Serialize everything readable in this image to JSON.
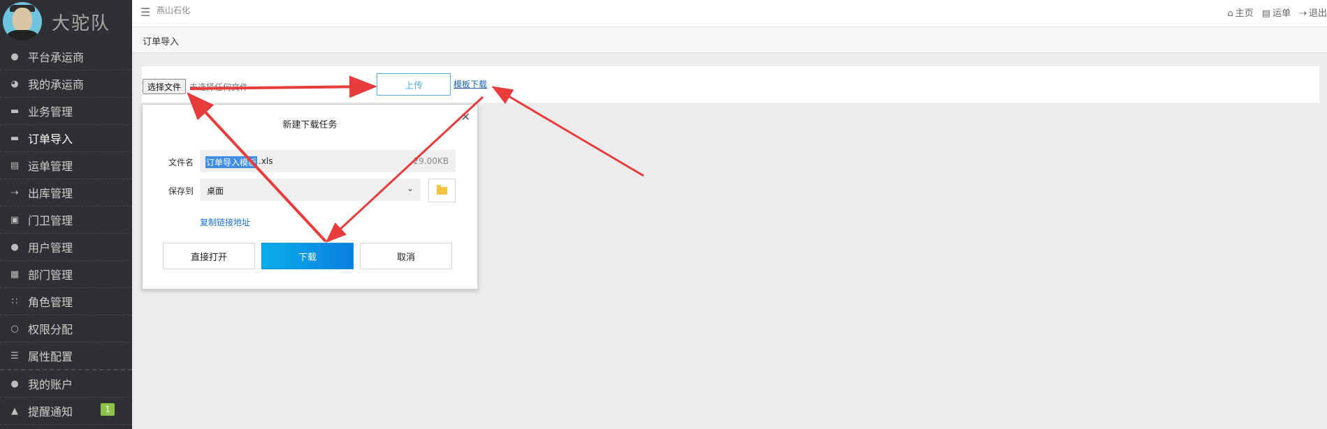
{
  "sidebar": {
    "brand": "大驼队",
    "items": [
      {
        "label": "平台承运商",
        "icon": "user-icon"
      },
      {
        "label": "我的承运商",
        "icon": "pie-chart-icon"
      },
      {
        "label": "业务管理",
        "icon": "folder-icon"
      },
      {
        "label": "订单导入",
        "icon": "folder-icon",
        "active": true
      },
      {
        "label": "运单管理",
        "icon": "document-icon"
      },
      {
        "label": "出库管理",
        "icon": "sign-out-icon"
      },
      {
        "label": "门卫管理",
        "icon": "clipboard-icon"
      },
      {
        "label": "用户管理",
        "icon": "users-icon"
      },
      {
        "label": "部门管理",
        "icon": "grid-icon"
      },
      {
        "label": "角色管理",
        "icon": "dots-grid-icon"
      },
      {
        "label": "权限分配",
        "icon": "unlock-icon"
      },
      {
        "label": "属性配置",
        "icon": "list-icon"
      },
      {
        "label": "我的账户",
        "icon": "account-icon"
      },
      {
        "label": "提醒通知",
        "icon": "bell-icon",
        "badge": "1"
      }
    ],
    "badge_color": "#8bc34a"
  },
  "topbar": {
    "org": "燕山石化",
    "links": [
      {
        "label": "主页",
        "icon": "home-icon"
      },
      {
        "label": "运单",
        "icon": "file-icon"
      },
      {
        "label": "退出",
        "icon": "logout-icon"
      }
    ]
  },
  "breadcrumb": "订单导入",
  "upload": {
    "choose_label": "选择文件",
    "no_file_text": "未选择任何文件",
    "upload_label": "上传",
    "template_link": "模板下载"
  },
  "dialog": {
    "title": "新建下载任务",
    "filename_label": "文件名",
    "filename_selected": "订单导入模板",
    "filename_ext": ".xls",
    "file_size": "29.00KB",
    "saveto_label": "保存到",
    "saveto_value": "桌面",
    "copy_link": "复制链接地址",
    "btn_open": "直接打开",
    "btn_download": "下载",
    "btn_cancel": "取消"
  },
  "colors": {
    "sidebar_bg": "#2f3033",
    "primary": "#0a8de4",
    "annotation": "#e83b3b"
  }
}
